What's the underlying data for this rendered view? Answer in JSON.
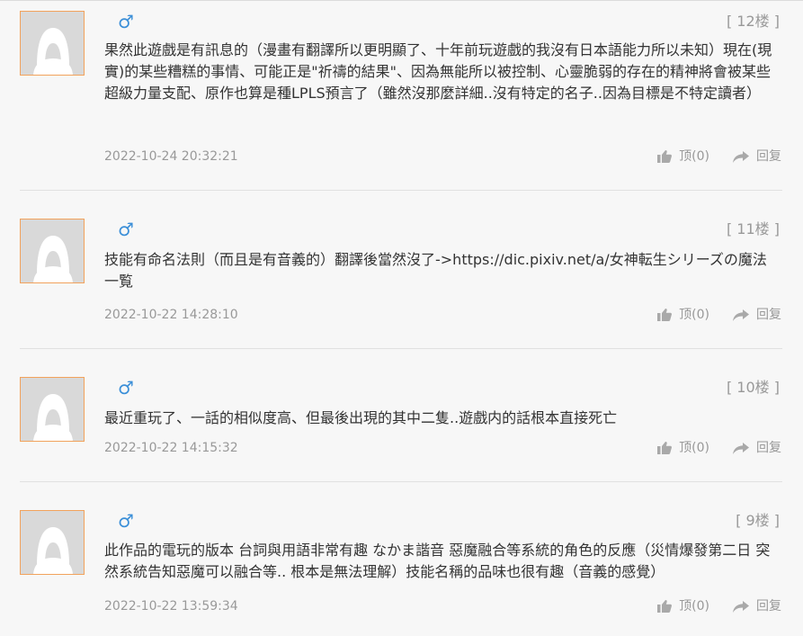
{
  "comments": [
    {
      "floor": "[ 12楼 ]",
      "gender_symbol": "♂",
      "content": "果然此遊戲是有訊息的（漫畫有翻譯所以更明顯了、十年前玩遊戲的我沒有日本語能力所以未知）現在(現實)的某些糟糕的事情、可能正是\"祈禱的結果\"、因為無能所以被控制、心靈脆弱的存在的精神將會被某些超級力量支配、原作也算是種LPLS預言了（雖然沒那麼詳細..沒有特定的名子..因為目標是不特定讀者）",
      "timestamp": "2022-10-24 20:32:21",
      "like_label": "顶(0)",
      "reply_label": "回复"
    },
    {
      "floor": "[ 11楼 ]",
      "gender_symbol": "♂",
      "content": "技能有命名法則（而且是有音義的）翻譯後當然沒了->https://dic.pixiv.net/a/女神転生シリーズの魔法一覧",
      "timestamp": "2022-10-22 14:28:10",
      "like_label": "顶(0)",
      "reply_label": "回复"
    },
    {
      "floor": "[ 10楼 ]",
      "gender_symbol": "♂",
      "content": "最近重玩了、一話的相似度高、但最後出現的其中二隻..遊戲内的話根本直接死亡",
      "timestamp": "2022-10-22 14:15:32",
      "like_label": "顶(0)",
      "reply_label": "回复"
    },
    {
      "floor": "[ 9楼 ]",
      "gender_symbol": "♂",
      "content": "此作品的電玩的版本 台詞與用語非常有趣 なかま諧音 惡魔融合等系統的角色的反應（災情爆發第二日 突然系統告知惡魔可以融合等.. 根本是無法理解）技能名稱的品味也很有趣（音義的感覺）",
      "timestamp": "2022-10-22 13:59:34",
      "like_label": "顶(0)",
      "reply_label": "回复"
    }
  ],
  "colors": {
    "avatar_border": "#f2a25c",
    "gender_blue": "#3b8fd8",
    "muted_text": "#999999",
    "body_text": "#333333"
  }
}
